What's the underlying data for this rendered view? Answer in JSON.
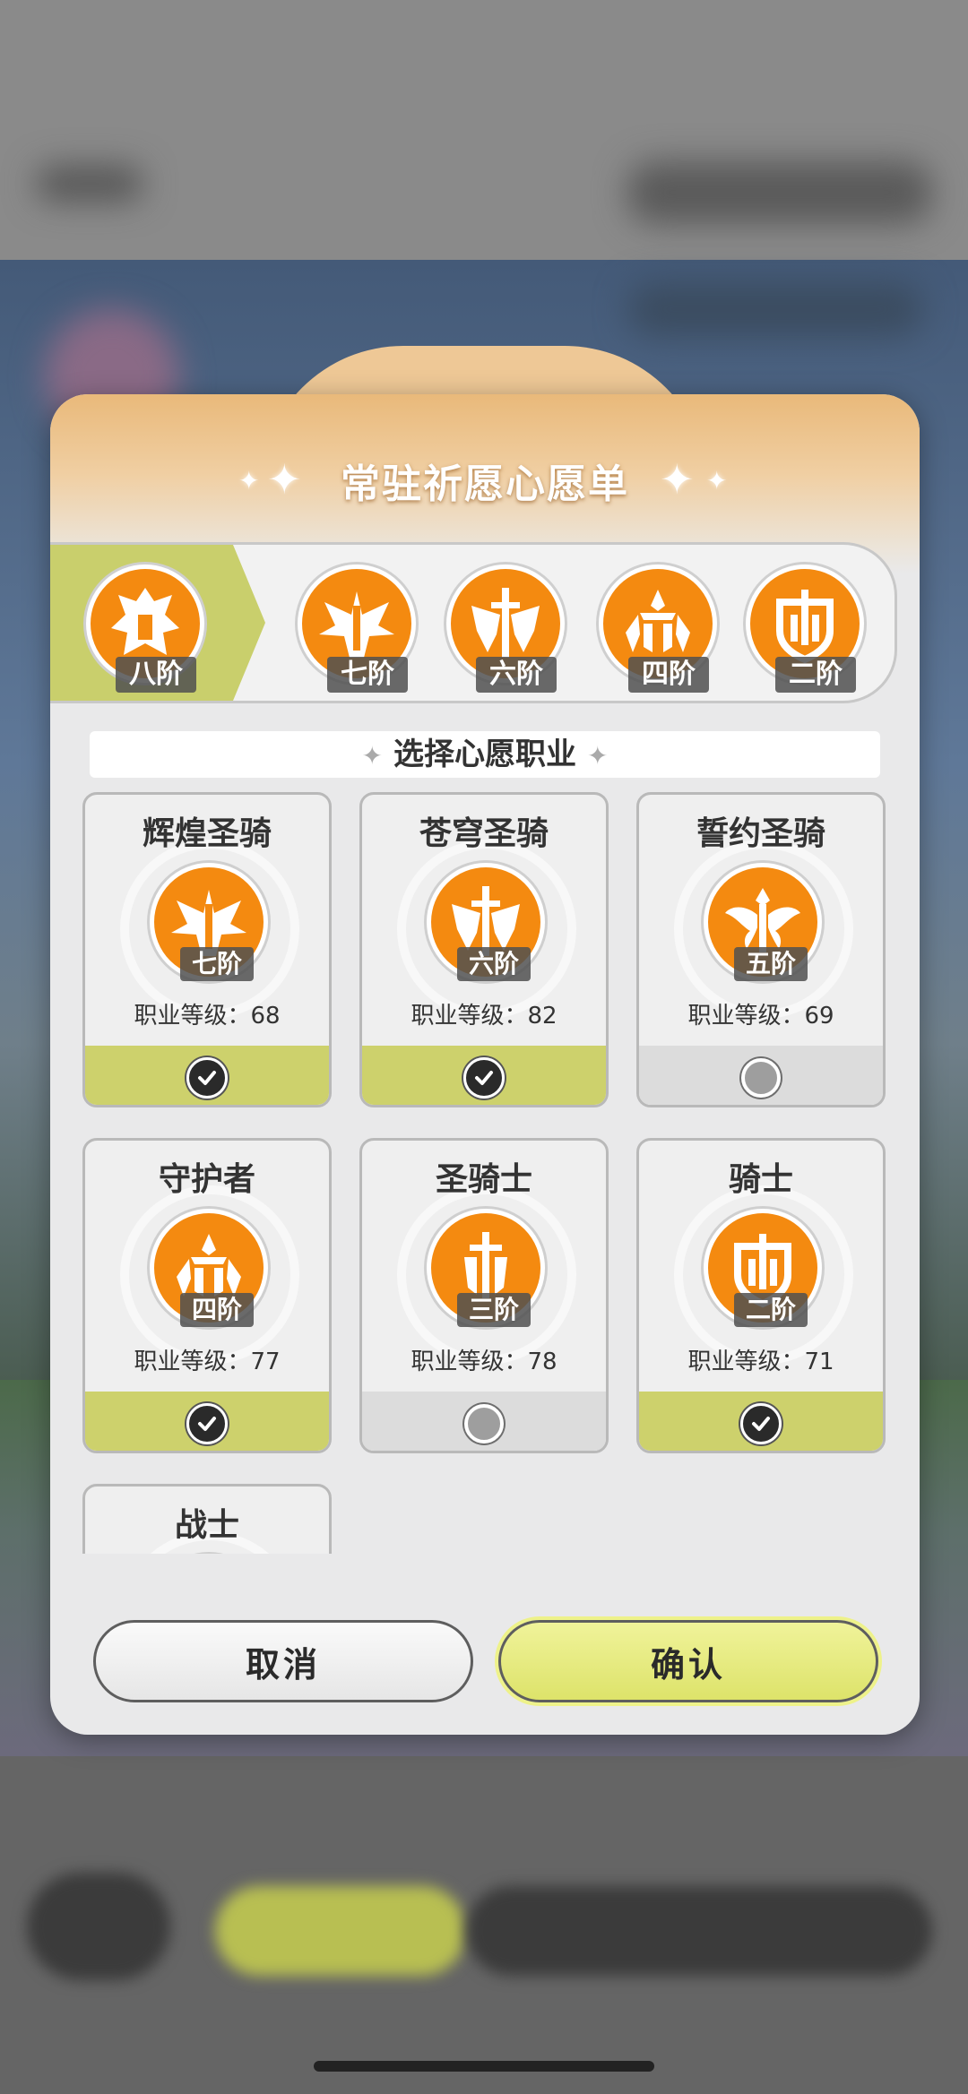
{
  "modal": {
    "title": "常驻祈愿心愿单",
    "section_title": "选择心愿职业"
  },
  "tiers": [
    {
      "label": "八阶",
      "active": true,
      "icon": "knight-helmet-emblem-icon"
    },
    {
      "label": "七阶",
      "active": false,
      "icon": "winged-knight-emblem-icon"
    },
    {
      "label": "六阶",
      "active": false,
      "icon": "sword-wings-emblem-icon"
    },
    {
      "label": "四阶",
      "active": false,
      "icon": "guardian-crest-emblem-icon"
    },
    {
      "label": "二阶",
      "active": false,
      "icon": "shield-emblem-icon"
    }
  ],
  "classes": [
    {
      "name": "辉煌圣骑",
      "tier": "七阶",
      "level_text": "职业等级：68",
      "selected": true,
      "icon": "winged-knight-emblem-icon"
    },
    {
      "name": "苍穹圣骑",
      "tier": "六阶",
      "level_text": "职业等级：82",
      "selected": true,
      "icon": "sword-wings-emblem-icon"
    },
    {
      "name": "誓约圣骑",
      "tier": "五阶",
      "level_text": "职业等级：69",
      "selected": false,
      "icon": "angel-wings-emblem-icon"
    },
    {
      "name": "守护者",
      "tier": "四阶",
      "level_text": "职业等级：77",
      "selected": true,
      "icon": "guardian-crest-emblem-icon"
    },
    {
      "name": "圣骑士",
      "tier": "三阶",
      "level_text": "职业等级：78",
      "selected": false,
      "icon": "sword-shield-emblem-icon"
    },
    {
      "name": "骑士",
      "tier": "二阶",
      "level_text": "职业等级：71",
      "selected": true,
      "icon": "shield-emblem-icon"
    },
    {
      "name": "战士",
      "tier": "",
      "level_text": "",
      "selected": false,
      "icon": "warrior-emblem-icon"
    }
  ],
  "buttons": {
    "cancel_label": "取消",
    "confirm_label": "确认"
  },
  "colors": {
    "accent_orange": "#f48a10",
    "selected_green": "#cdd16c",
    "confirm_yellow": "#dde36a"
  }
}
